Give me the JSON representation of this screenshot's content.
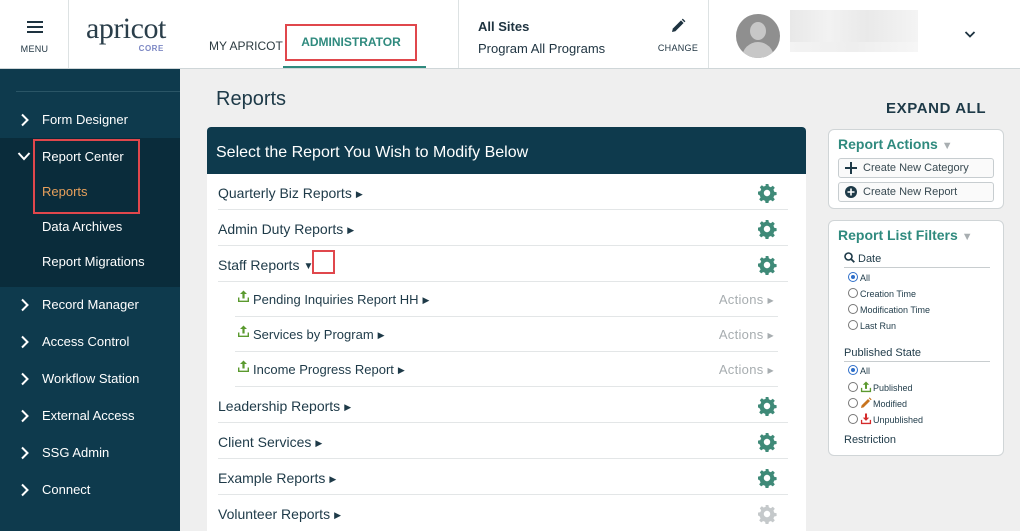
{
  "header": {
    "menu_label": "MENU",
    "logo_word": "apricot",
    "logo_sub": "CORE",
    "nav": {
      "my_apricot": "MY APRICOT",
      "administrator": "ADMINISTRATOR"
    },
    "site_title": "All Sites",
    "site_program": "Program All Programs",
    "change_label": "CHANGE",
    "icons": {
      "menu": "hamburger-icon",
      "change": "pencil-icon",
      "account": "chevron-down-icon",
      "avatar": "user-avatar-icon"
    }
  },
  "sidebar": {
    "items": [
      {
        "label": "Form Designer"
      },
      {
        "label": "Report Center"
      },
      {
        "label": "Record Manager"
      },
      {
        "label": "Access Control"
      },
      {
        "label": "Workflow Station"
      },
      {
        "label": "External Access"
      },
      {
        "label": "SSG Admin"
      },
      {
        "label": "Connect"
      }
    ],
    "report_center_children": [
      {
        "label": "Reports",
        "active": true
      },
      {
        "label": "Data Archives"
      },
      {
        "label": "Report Migrations"
      }
    ]
  },
  "main": {
    "title": "Reports",
    "expand_all": "EXPAND ALL",
    "panel_title": "Select the Report You Wish to Modify Below",
    "categories": [
      {
        "name": "Quarterly Biz Reports"
      },
      {
        "name": "Admin Duty Reports"
      },
      {
        "name": "Staff Reports"
      },
      {
        "name": "Leadership Reports"
      },
      {
        "name": "Client Services"
      },
      {
        "name": "Example Reports"
      },
      {
        "name": "Volunteer Reports"
      }
    ],
    "staff_reports": [
      {
        "name": "Pending Inquiries Report HH",
        "actions": "Actions"
      },
      {
        "name": "Services by Program",
        "actions": "Actions"
      },
      {
        "name": "Income Progress Report",
        "actions": "Actions"
      }
    ]
  },
  "report_actions": {
    "title": "Report Actions",
    "create_category": "Create New Category",
    "create_report": "Create New Report"
  },
  "filters": {
    "title": "Report List Filters",
    "date_label": "Date",
    "date_options": [
      "All",
      "Creation Time",
      "Modification Time",
      "Last Run"
    ],
    "date_selected": "All",
    "published_label": "Published State",
    "published_options": [
      "All",
      "Published",
      "Modified",
      "Unpublished"
    ],
    "published_selected": "All",
    "restriction_label": "Restriction"
  },
  "colors": {
    "sidebar_bg": "#0e3a4d",
    "accent_teal": "#2f8a7e",
    "active_orange": "#e7a05c",
    "gear_green": "#3f8a78",
    "highlight_red": "#e0474c"
  }
}
